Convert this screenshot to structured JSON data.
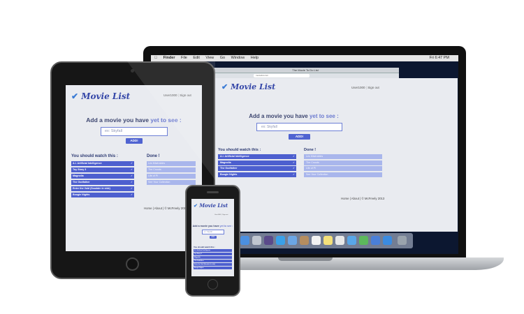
{
  "mac": {
    "menu": [
      "Finder",
      "File",
      "Edit",
      "View",
      "Go",
      "Window",
      "Help"
    ],
    "clock": "Fri 6:47 PM",
    "browser_title": "The Movie To Do List",
    "url": "movielist.com"
  },
  "app": {
    "logo": "Movie List",
    "user": "User1000",
    "signout": "Sign out",
    "heading_main": "Add a movie you have ",
    "heading_accent": "yet to see :",
    "placeholder": "ex: Skyfall",
    "add_label": "ADD!",
    "watch_title": "You should watch this :",
    "done_title": "Done !",
    "watch_items": [
      "A.I. Artificial Intelligence",
      "Toy Story 3",
      "Magnolia",
      "The Godfather",
      "Enter the Void (Soudain le vide)",
      "Boogie Nights"
    ],
    "done_items": [
      "Les Misérables",
      "The Croods",
      "Life of Pi",
      "See Your Collection"
    ],
    "footer_home": "Home",
    "footer_about": "About",
    "footer_copy": "© McFreely 2013"
  },
  "colors": {
    "accent": "#4d5fcf",
    "done_item": "#a9b6ec",
    "page_bg": "#e9ebf0",
    "logo": "#3547a8"
  }
}
